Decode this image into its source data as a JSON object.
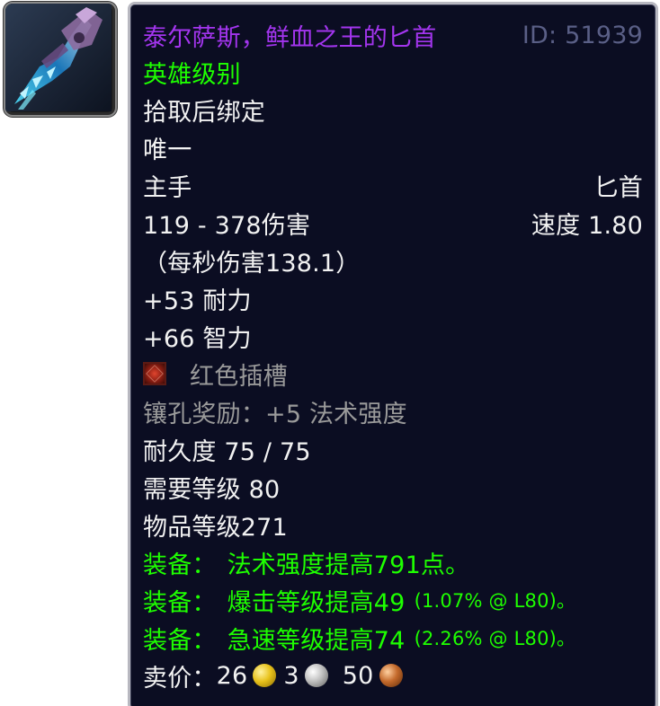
{
  "item": {
    "icon": "dagger-item-icon",
    "name": "泰尔萨斯，鲜血之王的匕首",
    "id_label": "ID: 51939",
    "quality": "英雄级别",
    "binding": "拾取后绑定",
    "unique": "唯一",
    "slot": "主手",
    "type": "匕首",
    "damage": "119 - 378伤害",
    "speed": "速度 1.80",
    "dps": "（每秒伤害138.1）",
    "stats": [
      "+53 耐力",
      "+66 智力"
    ],
    "socket": {
      "icon": "red-socket-icon",
      "label": "红色插槽"
    },
    "socket_bonus": "镶孔奖励：+5 法术强度",
    "durability": "耐久度 75 / 75",
    "required_level": "需要等级 80",
    "item_level": "物品等级271",
    "equip_effects": [
      {
        "prefix": "装备：",
        "text": "法术强度提高791点。",
        "note": ""
      },
      {
        "prefix": "装备：",
        "text": "爆击等级提高49",
        "note": "(1.07% @ L80)。"
      },
      {
        "prefix": "装备：",
        "text": "急速等级提高74",
        "note": "(2.26% @ L80)。"
      }
    ],
    "sell_price": {
      "label": "卖价：",
      "gold": "26",
      "silver": "3",
      "copper": "50"
    }
  },
  "colors": {
    "epic_purple": "#a335ee",
    "heroic_green": "#1eff00",
    "tooltip_bg": "#0b0d22",
    "id_grey": "#5a5f86",
    "inactive_grey": "#9a9a9a"
  }
}
